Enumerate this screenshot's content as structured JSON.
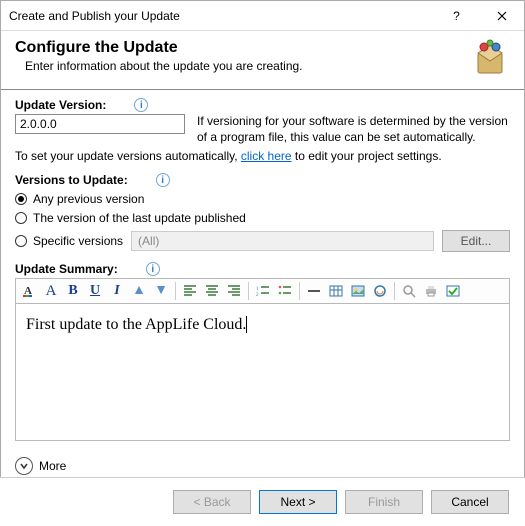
{
  "window": {
    "title": "Create and Publish your Update"
  },
  "header": {
    "title": "Configure the Update",
    "subtitle": "Enter information about the update you are creating."
  },
  "version": {
    "label": "Update Version:",
    "value": "2.0.0.0",
    "desc": "If versioning for your software is determined by the version of a program file, this value can be set automatically.",
    "auto_prefix": "To set your update versions automatically, ",
    "auto_link": "click here",
    "auto_suffix": " to edit your project settings."
  },
  "targets": {
    "label": "Versions to Update:",
    "opt_any": "Any previous version",
    "opt_last": "The version of the last update published",
    "opt_specific": "Specific versions",
    "all_placeholder": "(All)",
    "edit_label": "Edit..."
  },
  "summary": {
    "label": "Update Summary:",
    "text": "First update to the AppLife Cloud."
  },
  "more": {
    "label": "More"
  },
  "footer": {
    "back": "< Back",
    "next": "Next >",
    "finish": "Finish",
    "cancel": "Cancel"
  }
}
